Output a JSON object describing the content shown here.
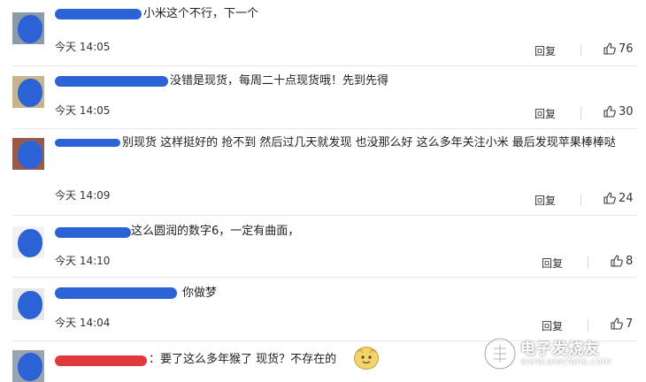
{
  "comments": [
    {
      "text": "小米这个不行，下一个",
      "time": "今天 14:05",
      "reply": "回复",
      "likes": "76"
    },
    {
      "text": "没错是现货，每周二十点现货哦！先到先得",
      "time": "今天 14:05",
      "reply": "回复",
      "likes": "30"
    },
    {
      "text": "别现货 这样挺好的 抢不到 然后过几天就发现 也没那么好 这么多年关注小米 最后发现苹果棒棒哒",
      "time": "今天 14:09",
      "reply": "回复",
      "likes": "24"
    },
    {
      "text": "这么圆润的数字6，一定有曲面，",
      "time": "今天 14:10",
      "reply": "回复",
      "likes": "8"
    },
    {
      "text": "你做梦",
      "time": "今天 14:04",
      "reply": "回复",
      "likes": "7"
    },
    {
      "text": "：要了这么多年猴了 现货？不存在的",
      "time": "",
      "reply": "",
      "likes": ""
    }
  ],
  "icons": {
    "like": "thumbs-up-icon",
    "emoji": "cat-face-emoji-icon",
    "watermark": "electronic-fans-logo-icon"
  },
  "watermark": {
    "text": "电子发烧友",
    "url": "www.elecfans.com"
  },
  "colors": {
    "name_redaction": "#2b63d6",
    "name_redaction_red": "#e0383b"
  }
}
